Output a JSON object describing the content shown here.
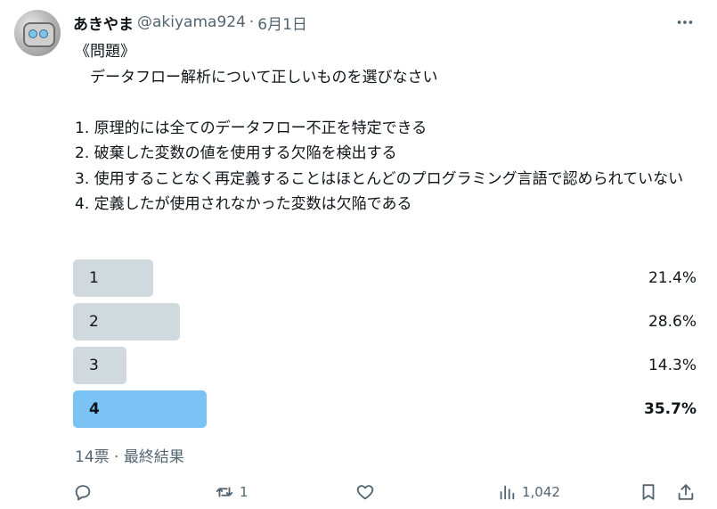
{
  "author": {
    "display_name": "あきやま",
    "handle": "@akiyama924",
    "separator": "·",
    "date": "6月1日"
  },
  "tweet": {
    "text": "《問題》\n　データフロー解析について正しいものを選びなさい\n\n1. 原理的には全てのデータフロー不正を特定できる\n2. 破棄した変数の値を使用する欠陥を検出する\n3. 使用することなく再定義することはほとんどのプログラミング言語で認められていない\n4. 定義したが使用されなかった変数は欠陥である"
  },
  "poll": {
    "options": [
      {
        "label": "1",
        "percent_text": "21.4%",
        "percent": 21.4,
        "winner": false
      },
      {
        "label": "2",
        "percent_text": "28.6%",
        "percent": 28.6,
        "winner": false
      },
      {
        "label": "3",
        "percent_text": "14.3%",
        "percent": 14.3,
        "winner": false
      },
      {
        "label": "4",
        "percent_text": "35.7%",
        "percent": 35.7,
        "winner": true
      }
    ],
    "meta": "14票 · 最終結果"
  },
  "actions": {
    "reply": {
      "icon": "reply-icon",
      "count": ""
    },
    "retweet": {
      "icon": "retweet-icon",
      "count": "1"
    },
    "like": {
      "icon": "heart-icon",
      "count": ""
    },
    "views": {
      "icon": "analytics-icon",
      "count": "1,042"
    },
    "bookmark": {
      "icon": "bookmark-icon"
    },
    "share": {
      "icon": "share-icon"
    }
  },
  "colors": {
    "bar": "#cfd9de",
    "winner_bar": "#7bc3f4",
    "muted_text": "#536471",
    "text": "#0f1419"
  }
}
